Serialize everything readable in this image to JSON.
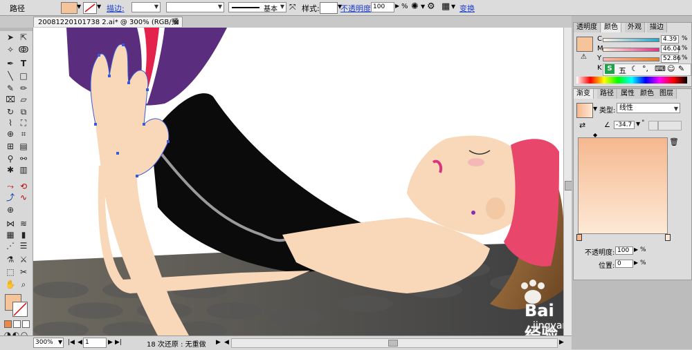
{
  "control_bar": {
    "object_type": "路径",
    "stroke_label": "描边:",
    "stroke_style": "基本",
    "style_label": "样式:",
    "opacity_label": "不透明度:",
    "opacity_value": "100",
    "opacity_unit": "%",
    "transform_label": "变换"
  },
  "document": {
    "tab_title": "20081220101738 2.ai* @ 300% (RGB/预览)",
    "zoom": "300%",
    "page": "1",
    "status_text": "18 次还原 : 无重做"
  },
  "transparency_panel": {
    "tabs": [
      "透明度",
      "颜色",
      "外观",
      "描边"
    ],
    "active_tab": "颜色",
    "channels": [
      {
        "label": "C",
        "value": "4.39",
        "percent": 4.39
      },
      {
        "label": "M",
        "value": "46.04",
        "percent": 46.04
      },
      {
        "label": "Y",
        "value": "52.86",
        "percent": 52.86
      },
      {
        "label": "K",
        "value": "",
        "percent": 0
      }
    ]
  },
  "gradient_panel": {
    "tabs": [
      "渐变",
      "路径",
      "属性",
      "颜色",
      "图层"
    ],
    "active_tab": "渐变",
    "type_label": "类型:",
    "type_value": "线性",
    "angle_value": "-34.7",
    "angle_unit": "°",
    "opacity_label": "不透明度:",
    "opacity_value": "100",
    "opacity_unit": "%",
    "location_label": "位置:",
    "location_value": "0",
    "location_unit": "%"
  },
  "ime_toolbar": {
    "logo": "S",
    "label": "五"
  },
  "watermark": {
    "text": "Bai 经验",
    "url": "jingyan.baidu.com"
  },
  "colors": {
    "fill": "#f6c49b",
    "gradient_start": "#f5b88f",
    "gradient_end": "#fde9d6",
    "accent_link": "#1d3fc8"
  }
}
